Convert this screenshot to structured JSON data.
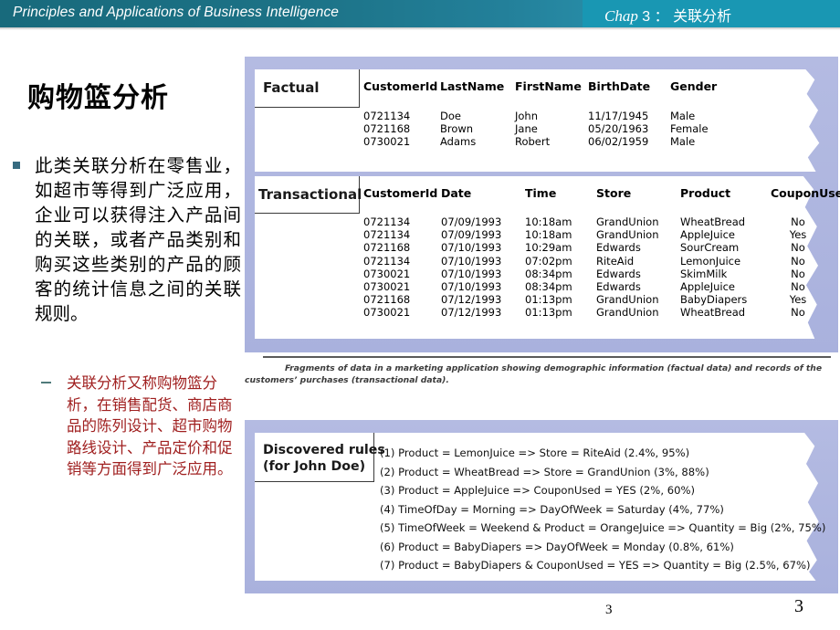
{
  "header": {
    "title": "Principles and Applications of Business Intelligence",
    "chapter_word": "Chap",
    "chapter_rest": "3 ： 关联分析",
    "accent_dark": "#186a7c",
    "accent_light": "#1997b3"
  },
  "slide": {
    "heading": "购物篮分析",
    "bullets": [
      {
        "marker": "square",
        "color": "#000000",
        "text": "此类关联分析在零售业，如超市等得到广泛应用，企业可以获得注入产品间的关联，或者产品类别和购买这些类别的产品的顾客的统计信息之间的关联规则。"
      },
      {
        "marker": "dash",
        "color": "#a02020",
        "text": "关联分析又称购物篮分析，在销售配货、商店商品的陈列设计、超市购物路线设计、产品定价和促销等方面得到广泛应用。"
      }
    ]
  },
  "figure": {
    "panel_color": "#aeb6e0",
    "factual": {
      "label": "Factual",
      "columns": [
        "CustomerId",
        "LastName",
        "FirstName",
        "BirthDate",
        "Gender"
      ],
      "rows": [
        [
          "0721134",
          "Doe",
          "John",
          "11/17/1945",
          "Male"
        ],
        [
          "0721168",
          "Brown",
          "Jane",
          "05/20/1963",
          "Female"
        ],
        [
          "0730021",
          "Adams",
          "Robert",
          "06/02/1959",
          "Male"
        ]
      ]
    },
    "transactional": {
      "label": "Transactional",
      "columns": [
        "CustomerId",
        "Date",
        "Time",
        "Store",
        "Product",
        "CouponUsed"
      ],
      "rows": [
        [
          "0721134",
          "07/09/1993",
          "10:18am",
          "GrandUnion",
          "WheatBread",
          "No"
        ],
        [
          "0721134",
          "07/09/1993",
          "10:18am",
          "GrandUnion",
          "AppleJuice",
          "Yes"
        ],
        [
          "0721168",
          "07/10/1993",
          "10:29am",
          "Edwards",
          "SourCream",
          "No"
        ],
        [
          "0721134",
          "07/10/1993",
          "07:02pm",
          "RiteAid",
          "LemonJuice",
          "No"
        ],
        [
          "0730021",
          "07/10/1993",
          "08:34pm",
          "Edwards",
          "SkimMilk",
          "No"
        ],
        [
          "0730021",
          "07/10/1993",
          "08:34pm",
          "Edwards",
          "AppleJuice",
          "No"
        ],
        [
          "0721168",
          "07/12/1993",
          "01:13pm",
          "GrandUnion",
          "BabyDiapers",
          "Yes"
        ],
        [
          "0730021",
          "07/12/1993",
          "01:13pm",
          "GrandUnion",
          "WheatBread",
          "No"
        ]
      ]
    },
    "caption": "Fragments of data in a marketing application showing demographic information (factual data) and records of the customers’ purchases (transactional data).",
    "rules": {
      "label": "Discovered rules\n(for John Doe)",
      "label_line1": "Discovered rules",
      "label_line2": "(for John Doe)",
      "items": [
        "(1) Product = LemonJuice => Store = RiteAid (2.4%, 95%)",
        "(2) Product = WheatBread => Store = GrandUnion (3%, 88%)",
        "(3) Product = AppleJuice => CouponUsed = YES (2%, 60%)",
        "(4) TimeOfDay = Morning => DayOfWeek = Saturday (4%, 77%)",
        "(5) TimeOfWeek = Weekend & Product = OrangeJuice => Quantity = Big (2%, 75%)",
        "(6) Product = BabyDiapers => DayOfWeek = Monday (0.8%, 61%)",
        "(7) Product = BabyDiapers & CouponUsed = YES => Quantity = Big (2.5%, 67%)"
      ]
    }
  },
  "footer": {
    "page_number_center": "3",
    "page_number_right": "3"
  }
}
